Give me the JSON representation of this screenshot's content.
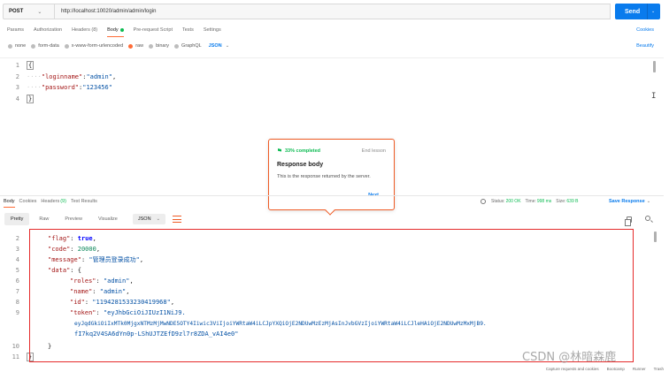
{
  "request": {
    "method": "POST",
    "url": "http://localhost:10020/admin/admin/login",
    "send_label": "Send"
  },
  "request_tabs": {
    "params": "Params",
    "authorization": "Authorization",
    "headers": "Headers (8)",
    "body": "Body",
    "prerequest": "Pre-request Script",
    "tests": "Tests",
    "settings": "Settings",
    "cookies": "Cookies"
  },
  "body_types": {
    "none": "none",
    "form_data": "form-data",
    "urlencoded": "x-www-form-urlencoded",
    "raw": "raw",
    "binary": "binary",
    "graphql": "GraphQL",
    "format": "JSON",
    "beautify": "Beautify"
  },
  "request_body": {
    "line_numbers": [
      "1",
      "2",
      "3",
      "4"
    ],
    "open_brace": "{",
    "close_brace": "}",
    "loginname_key": "\"loginname\"",
    "loginname_value": "\"admin\"",
    "password_key": "\"password\"",
    "password_value": "\"123456\""
  },
  "tour": {
    "progress": "33% completed",
    "end_lesson": "End lesson",
    "title": "Response body",
    "description": "This is the response returned by the server.",
    "next": "Next"
  },
  "response_tabs": {
    "body": "Body",
    "cookies": "Cookies",
    "headers": "Headers",
    "headers_count": "(9)",
    "test_results": "Test Results"
  },
  "response_status": {
    "status_label": "Status:",
    "status_value": "200 OK",
    "time_label": "Time:",
    "time_value": "998 ms",
    "size_label": "Size:",
    "size_value": "639 B",
    "save_response": "Save Response"
  },
  "response_toolbar": {
    "pretty": "Pretty",
    "raw": "Raw",
    "preview": "Preview",
    "visualize": "Visualize",
    "format": "JSON"
  },
  "response_body": {
    "line_numbers": [
      "2",
      "3",
      "4",
      "5",
      "6",
      "7",
      "8",
      "9",
      "10",
      "11"
    ],
    "flag_key": "\"flag\"",
    "flag_value": "true",
    "code_key": "\"code\"",
    "code_value": "20000",
    "message_key": "\"message\"",
    "message_value": "\"管理员登录成功\"",
    "data_key": "\"data\"",
    "roles_key": "\"roles\"",
    "roles_value": "\"admin\"",
    "name_key": "\"name\"",
    "name_value": "\"admin\"",
    "id_key": "\"id\"",
    "id_value": "\"1194281533230419968\"",
    "token_key": "\"token\"",
    "token_line1": "\"eyJhbGciOiJIUzI1NiJ9.",
    "token_line2": "eyJqdGkiOiIxMTk0MjgxNTMzMjMwNDE5OTY4Iiwic3ViIjoiYWRtaW4iLCJpYXQiOjE2NDUwMzEzMjAsInJvbGVzIjoiYWRtaW4iLCJleHAiOjE2NDUwMzMxMjB9.",
    "token_line3": "fI7kq2V4SA6dYn0p-LShUJTZEfD9zl7r8ZDA_vAI4e0\"",
    "close_inner": "}",
    "close_outer": "}"
  },
  "footer": {
    "capture": "Capture requests and cookies",
    "bootcamp": "Bootcamp",
    "runner": "Runner",
    "trash": "Trash"
  },
  "watermark": "CSDN @林暗森鹿",
  "colors": {
    "accent_orange": "#ff6c37",
    "send_blue": "#097bed",
    "status_green": "#0cbb52",
    "highlight_red": "#e52b2b"
  }
}
